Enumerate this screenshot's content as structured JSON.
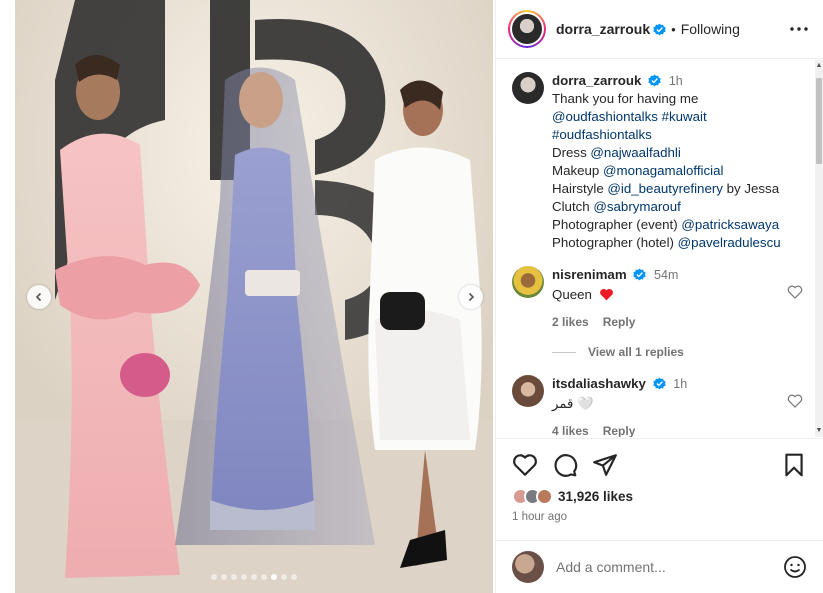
{
  "post": {
    "username": "dorra_zarrouk",
    "follow_status": "Following",
    "caption_time": "1h",
    "caption_lines": [
      {
        "text": "Thank you for having me",
        "type": "text"
      },
      {
        "text": "@oudfashiontalks #kuwait",
        "type": "link"
      },
      {
        "text": "#oudfashiontalks",
        "type": "link"
      },
      {
        "parts": [
          {
            "t": "Dress ",
            "link": false
          },
          {
            "t": "@najwaalfadhli",
            "link": true
          }
        ]
      },
      {
        "parts": [
          {
            "t": "Makeup ",
            "link": false
          },
          {
            "t": "@monagamalofficial",
            "link": true
          }
        ]
      },
      {
        "parts": [
          {
            "t": "Hairstyle ",
            "link": false
          },
          {
            "t": "@id_beautyrefinery",
            "link": true
          },
          {
            "t": " by Jessa",
            "link": false
          }
        ]
      },
      {
        "parts": [
          {
            "t": "Clutch ",
            "link": false
          },
          {
            "t": "@sabrymarouf",
            "link": true
          }
        ]
      },
      {
        "parts": [
          {
            "t": "Photographer (event) ",
            "link": false
          },
          {
            "t": "@patricksawaya",
            "link": true
          }
        ]
      },
      {
        "parts": [
          {
            "t": "Photographer (hotel) ",
            "link": false
          },
          {
            "t": "@pavelradulescu",
            "link": true
          }
        ]
      }
    ],
    "likes": "31,926 likes",
    "time_ago": "1 hour ago",
    "add_comment_placeholder": "Add a comment...",
    "carousel": {
      "count": 9,
      "active_index": 6
    }
  },
  "comments": [
    {
      "username": "nisrenimam",
      "time": "54m",
      "text": "Queen",
      "emoji": "red-heart",
      "likes": "2 likes",
      "reply": "Reply",
      "view_replies": "View all 1 replies"
    },
    {
      "username": "itsdaliashawky",
      "time": "1h",
      "text": "قمر 🤍",
      "likes": "4 likes",
      "reply": "Reply"
    }
  ],
  "colors": {
    "link": "#00376b",
    "verified": "#0095f6",
    "muted": "#737373",
    "heart_red": "#ed1c24"
  }
}
